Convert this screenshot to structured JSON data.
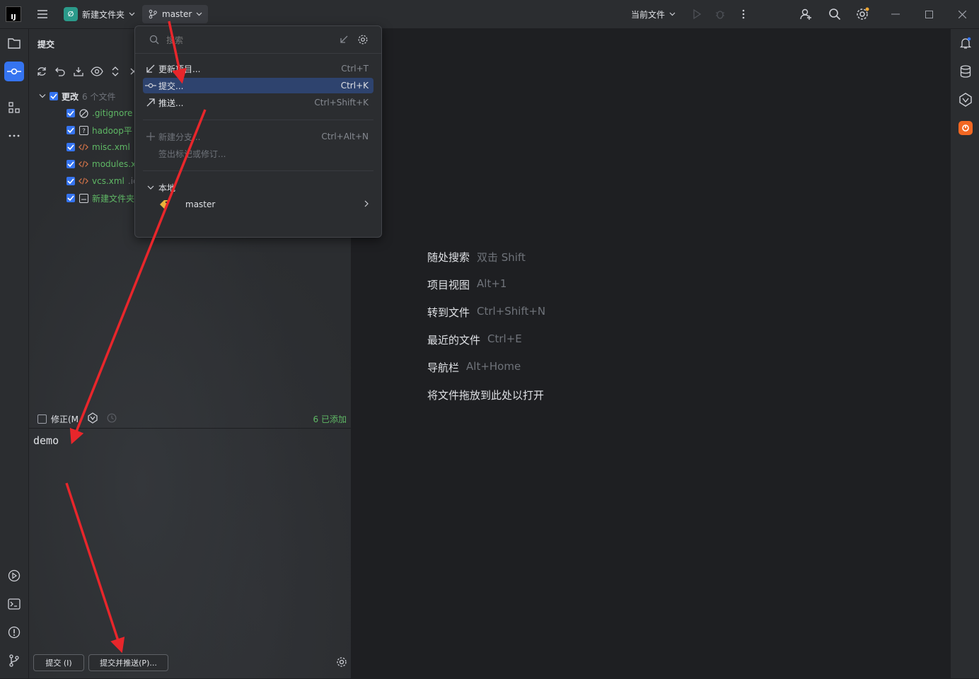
{
  "titlebar": {
    "app_logo": "IJ",
    "project_badge": "∅",
    "project_name": "新建文件夹",
    "branch": "master",
    "run_config": "当前文件"
  },
  "commit_panel": {
    "title": "提交",
    "changes_label": "更改",
    "changes_count": "6 个文件",
    "files": [
      {
        "name": ".gitignore",
        "icon": "gitignore-icon",
        "suffix": ""
      },
      {
        "name": "hadoop平",
        "icon": "unknown-file-icon",
        "suffix": ""
      },
      {
        "name": "misc.xml",
        "icon": "xml-icon",
        "suffix": "."
      },
      {
        "name": "modules.x",
        "icon": "xml-icon",
        "suffix": ""
      },
      {
        "name": "vcs.xml",
        "icon": "xml-icon",
        "suffix": ".ic"
      },
      {
        "name": "新建文件夹",
        "icon": "module-file-icon",
        "suffix": ""
      }
    ],
    "amend_label": "修正(M",
    "added_status": "6 已添加",
    "commit_message": "demo",
    "commit_button": "提交 (I)",
    "commit_push_button": "提交并推送(P)..."
  },
  "popup": {
    "search_placeholder": "搜索",
    "items": [
      {
        "label": "更新项目...",
        "shortcut": "Ctrl+T",
        "icon": "update-icon"
      },
      {
        "label": "提交...",
        "shortcut": "Ctrl+K",
        "icon": "commit-icon",
        "selected": true
      },
      {
        "label": "推送...",
        "shortcut": "Ctrl+Shift+K",
        "icon": "push-icon"
      }
    ],
    "new_branch": {
      "label": "新建分支...",
      "shortcut": "Ctrl+Alt+N"
    },
    "checkout_tag": "签出标记或修订...",
    "local_section": "本地",
    "local_branch": "master"
  },
  "editor_hints": [
    {
      "action": "随处搜索",
      "shortcut": "双击 Shift"
    },
    {
      "action": "项目视图",
      "shortcut": "Alt+1"
    },
    {
      "action": "转到文件",
      "shortcut": "Ctrl+Shift+N"
    },
    {
      "action": "最近的文件",
      "shortcut": "Ctrl+E"
    },
    {
      "action": "导航栏",
      "shortcut": "Alt+Home"
    },
    {
      "action": "将文件拖放到此处以打开",
      "shortcut": ""
    }
  ],
  "colors": {
    "accent": "#3574f0",
    "added_file": "#5fb865",
    "annotation_arrow": "#e8262b",
    "selection": "#2e436e"
  }
}
